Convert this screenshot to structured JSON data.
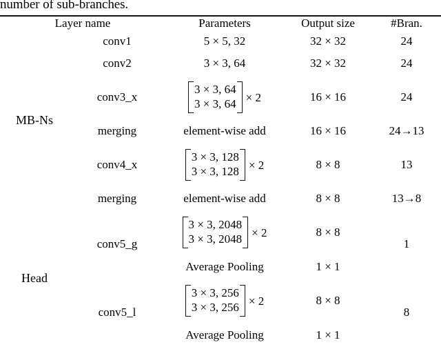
{
  "caption": {
    "text": "number of sub-branches."
  },
  "table": {
    "headers": [
      "Layer name",
      "Parameters",
      "Output size",
      "#Bran."
    ],
    "groups": [
      {
        "name": "MB-Ns",
        "rows": [
          {
            "layer": "conv1",
            "parameters": "5 × 5, 32",
            "parameters_type": "plain",
            "output_size": "32 × 32",
            "branches": "24"
          },
          {
            "layer": "conv2",
            "parameters": "3 × 3, 64",
            "parameters_type": "plain",
            "output_size": "32 × 32",
            "branches": "24"
          },
          {
            "layer": "conv3_x",
            "parameters_type": "matrix",
            "matrix_rows": [
              "3 × 3, 64",
              "3 × 3, 64"
            ],
            "multiplier": "× 2",
            "output_size": "16 × 16",
            "branches": "24"
          },
          {
            "layer": "merging",
            "parameters": "element-wise add",
            "parameters_type": "plain",
            "output_size": "16 × 16",
            "branches": "24→13"
          },
          {
            "layer": "conv4_x",
            "parameters_type": "matrix",
            "matrix_rows": [
              "3 × 3, 128",
              "3 × 3, 128"
            ],
            "multiplier": "× 2",
            "output_size": "8 × 8",
            "branches": "13"
          },
          {
            "layer": "merging",
            "parameters": "element-wise add",
            "parameters_type": "plain",
            "output_size": "8 × 8",
            "branches": "13→8"
          }
        ]
      },
      {
        "name": "Head",
        "rows": [
          {
            "layer": "conv5_g",
            "parameters_type": "matrix",
            "matrix_rows": [
              "3 × 3, 2048",
              "3 × 3, 2048"
            ],
            "multiplier": "× 2",
            "output_size": "8 × 8",
            "branches": "1",
            "sub": {
              "parameters": "Average Pooling",
              "output_size": "1 × 1"
            }
          },
          {
            "layer": "conv5_l",
            "parameters_type": "matrix",
            "matrix_rows": [
              "3 × 3, 256",
              "3 × 3, 256"
            ],
            "multiplier": "× 2",
            "output_size": "8 × 8",
            "branches": "8",
            "sub": {
              "parameters": "Average Pooling",
              "output_size": "1 × 1"
            }
          }
        ]
      }
    ]
  }
}
